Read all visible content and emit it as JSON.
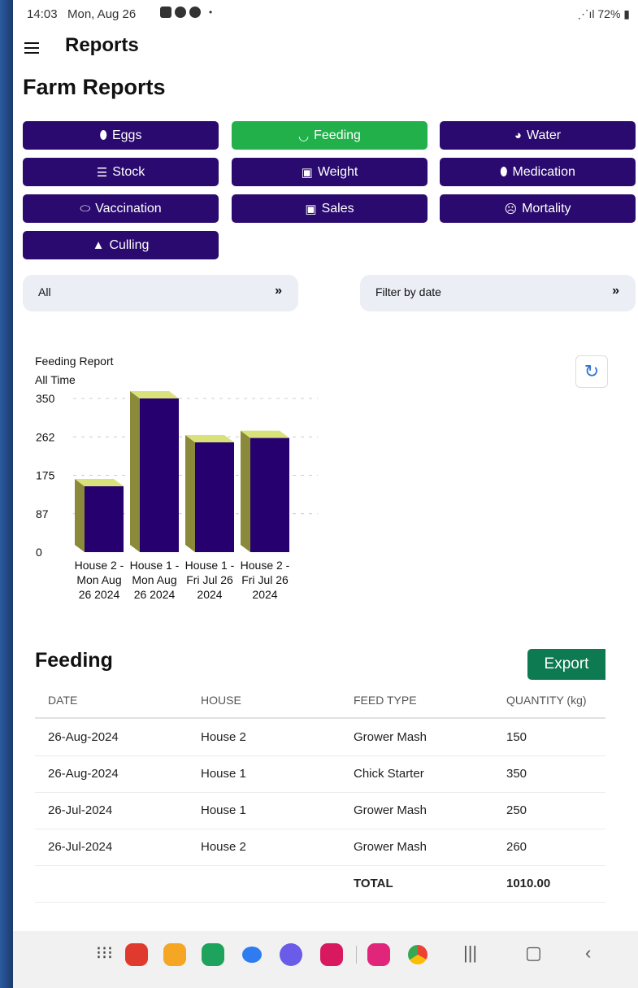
{
  "status": {
    "time": "14:03",
    "date": "Mon, Aug 26",
    "signal_battery": "72%"
  },
  "appbar": {
    "title": "Reports"
  },
  "page": {
    "title": "Farm Reports"
  },
  "report_buttons": [
    {
      "label": "Eggs",
      "icon": "egg-icon",
      "active": false
    },
    {
      "label": "Feeding",
      "icon": "bowl-icon",
      "active": true
    },
    {
      "label": "Water",
      "icon": "watering-can-icon",
      "active": false
    },
    {
      "label": "Stock",
      "icon": "database-icon",
      "active": false
    },
    {
      "label": "Weight",
      "icon": "scale-icon",
      "active": false
    },
    {
      "label": "Medication",
      "icon": "pills-icon",
      "active": false
    },
    {
      "label": "Vaccination",
      "icon": "capsule-icon",
      "active": false
    },
    {
      "label": "Sales",
      "icon": "money-icon",
      "active": false
    },
    {
      "label": "Mortality",
      "icon": "sad-face-icon",
      "active": false
    },
    {
      "label": "Culling",
      "icon": "warning-icon",
      "active": false
    }
  ],
  "filters": {
    "house": "All",
    "date": "Filter by date"
  },
  "chart_data": {
    "type": "bar",
    "title": "Feeding Report",
    "subtitle": "All Time",
    "categories": [
      [
        "House 2 -",
        "Mon Aug",
        "26 2024"
      ],
      [
        "House 1 -",
        "Mon Aug",
        "26 2024"
      ],
      [
        "House 1 -",
        "Fri Jul 26",
        "2024"
      ],
      [
        "House 2 -",
        "Fri Jul 26",
        "2024"
      ]
    ],
    "values": [
      150,
      350,
      250,
      260
    ],
    "yticks": [
      "350",
      "262",
      "175",
      "87",
      "0"
    ],
    "ylim": [
      0,
      350
    ],
    "grid": true,
    "colors": {
      "front": "#270070",
      "side": "#8a8a3a",
      "top": "#d9e27a"
    }
  },
  "table": {
    "title": "Feeding",
    "export_label": "Export",
    "headers": [
      "DATE",
      "HOUSE",
      "FEED TYPE",
      "QUANTITY (kg)"
    ],
    "rows": [
      [
        "26-Aug-2024",
        "House 2",
        "Grower Mash",
        "150"
      ],
      [
        "26-Aug-2024",
        "House 1",
        "Chick Starter",
        "350"
      ],
      [
        "26-Jul-2024",
        "House 1",
        "Grower Mash",
        "250"
      ],
      [
        "26-Jul-2024",
        "House 2",
        "Grower Mash",
        "260"
      ]
    ],
    "total_label": "TOTAL",
    "total_value": "1010.00"
  },
  "navbar": {
    "apps": [
      "apps-grid-icon",
      "flipboard-icon",
      "files-icon",
      "phone-icon",
      "messages-icon",
      "samsung-internet-icon",
      "camera-icon",
      "flower-app-icon",
      "chrome-icon"
    ],
    "system": [
      "recents-icon",
      "home-icon",
      "back-icon"
    ]
  }
}
